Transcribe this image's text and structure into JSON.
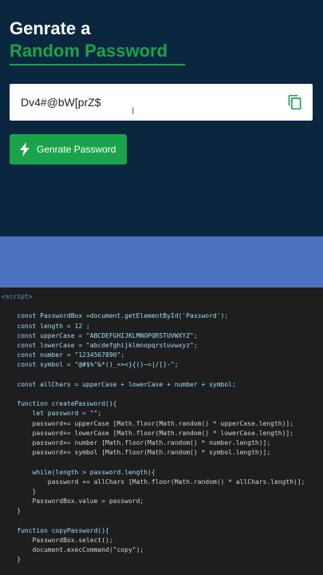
{
  "header": {
    "title_line1": "Genrate a",
    "title_line2": "Random Password"
  },
  "password_field": {
    "value": "Dv4#@bW[prZ$"
  },
  "generate_button": {
    "label": "Genrate Password"
  },
  "colors": {
    "accent": "#1aa34a",
    "hero_bg": "#0b2740",
    "band": "#4a70bf",
    "editor_bg": "#1e1e1e"
  },
  "code": {
    "lines": [
      "<script>",
      "",
      "    const PasswordBox =document.getElementById('Password');",
      "    const length = 12 ;",
      "    const upperCase = \"ABCDEFGHIJKLMNOPQRSTUVWXYZ\";",
      "    const lowerCase = \"abcdefghijklmnopqrstuvwxyz\";",
      "    const number = \"1234567890\";",
      "    const symbol = \"@#$%^&*()_+><}{()~=|/[]-\";",
      "",
      "    const allChars = upperCase + lowerCase + number + symbol;",
      "",
      "    function createPassword(){",
      "        let password = \"\";",
      "        password+= upperCase [Math.floor(Math.random() * upperCase.length)];",
      "        password+= lowerCase [Math.floor(Math.random() * lowerCase.length)];",
      "        password+= number [Math.floor(Math.random() * number.length)];",
      "        password+= symbol [Math.floor(Math.random() * symbol.length)];",
      "",
      "        while(length > password.length){",
      "            password += allChars [Math.floor(Math.random() * allChars.length)];",
      "        }",
      "        PasswordBox.value = password;",
      "    }",
      "",
      "    function copyPassword(){",
      "        PasswordBox.select();",
      "        document.execCommand(\"copy\");",
      "    }"
    ]
  }
}
